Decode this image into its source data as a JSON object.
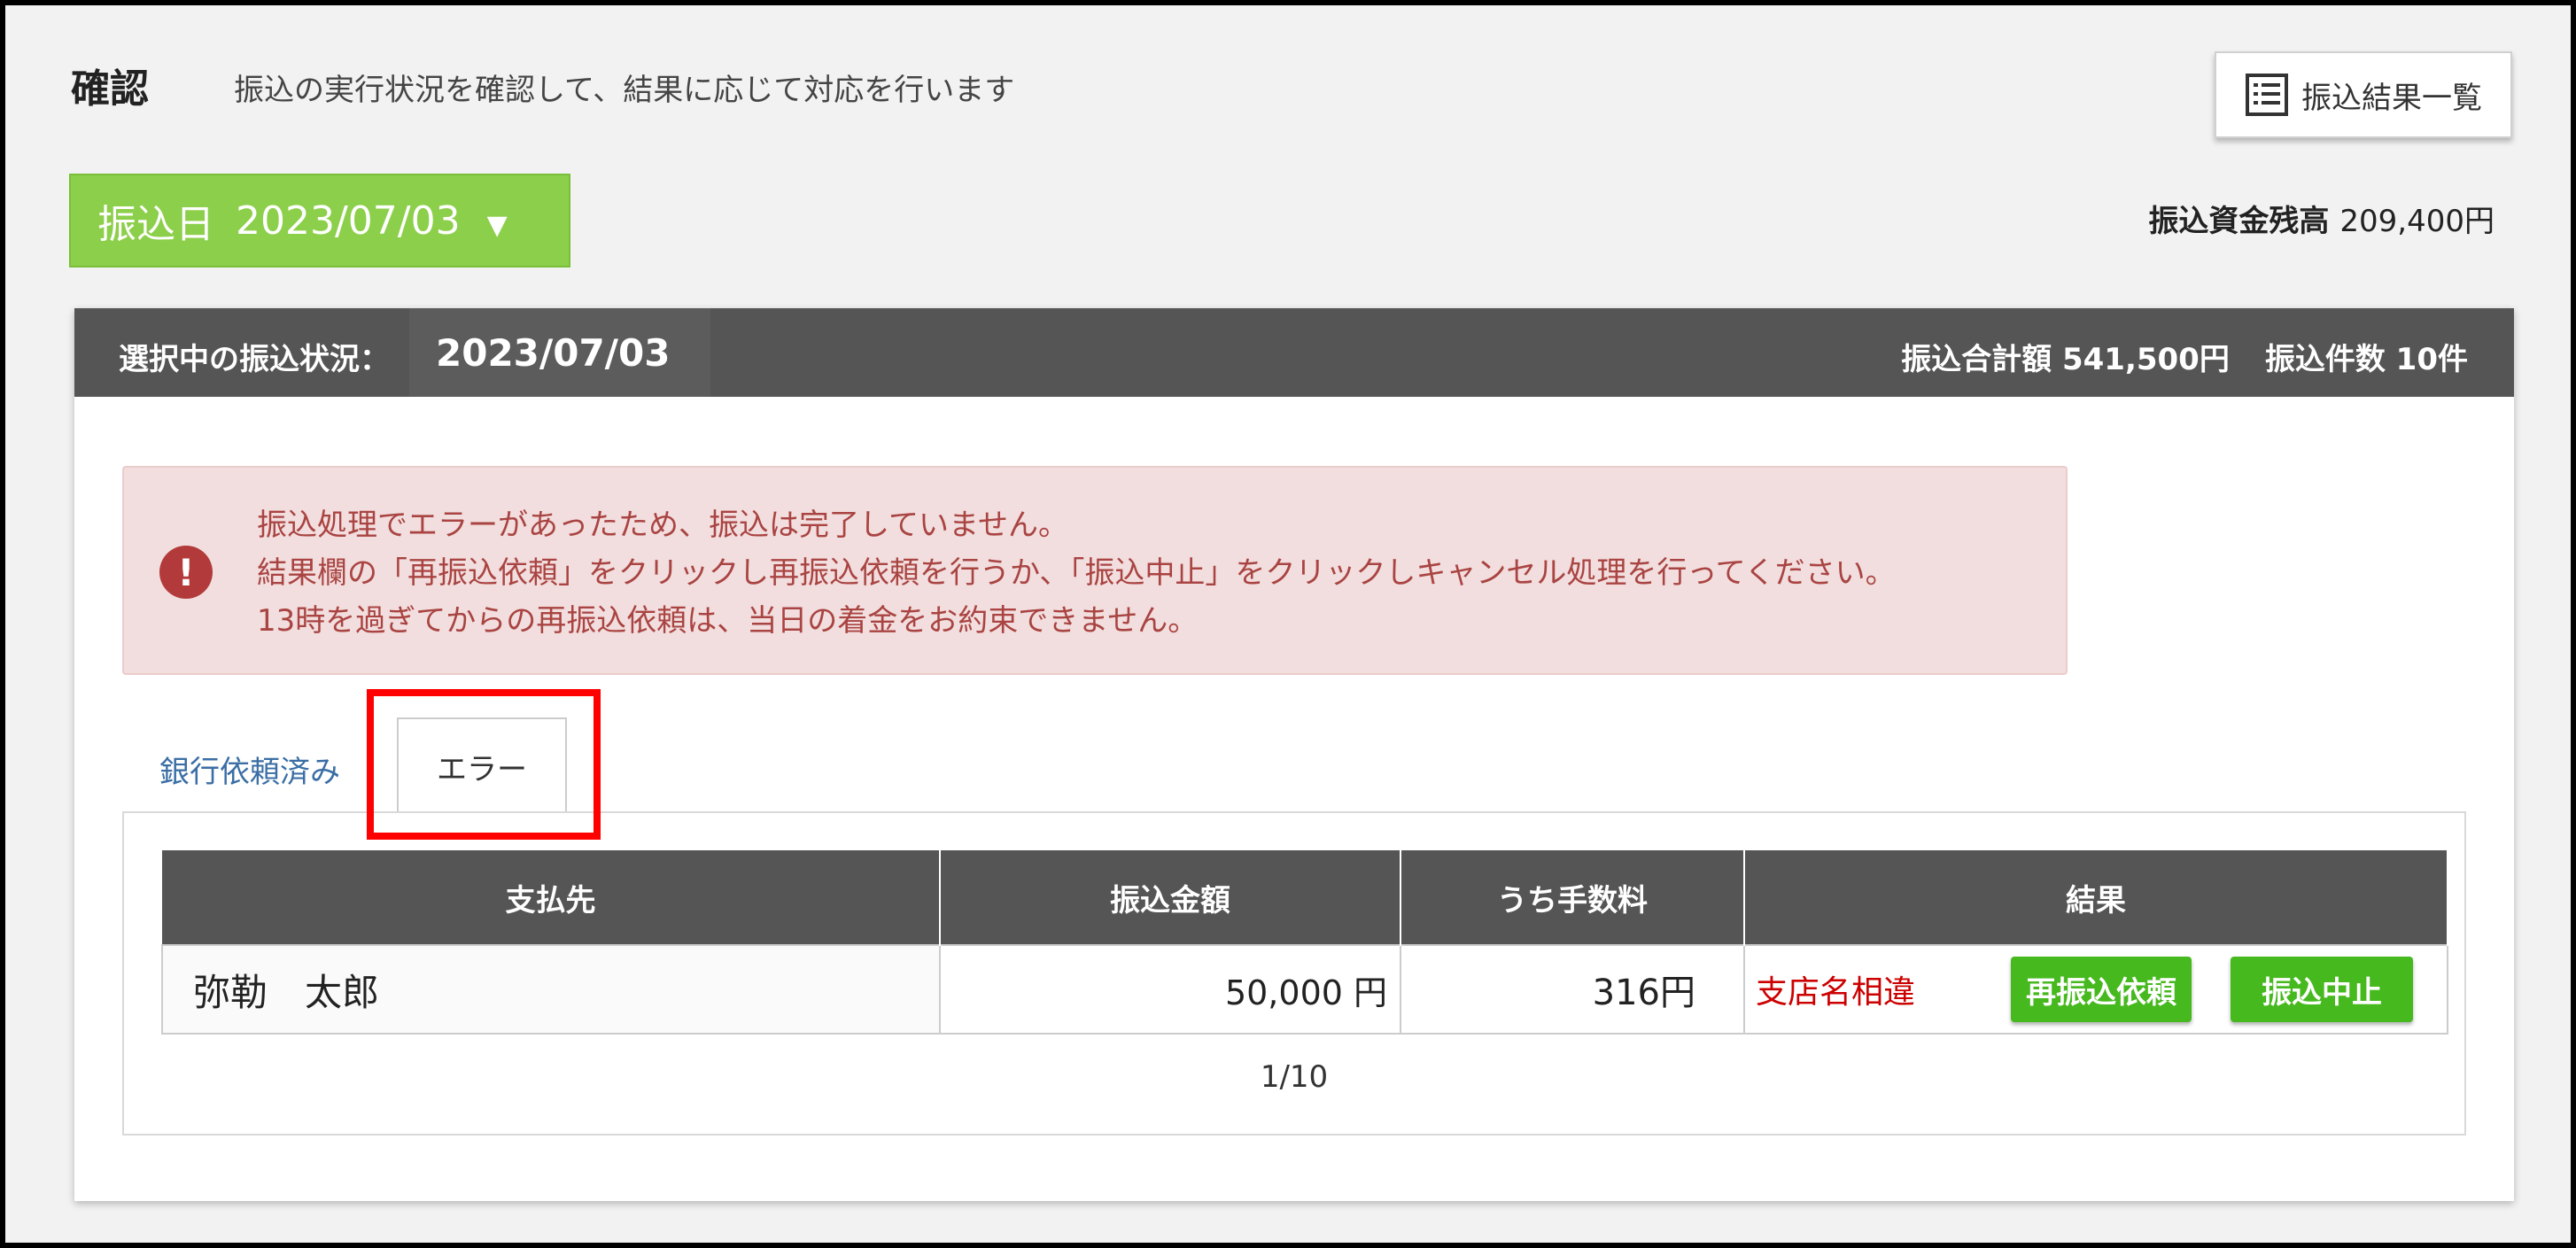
{
  "header": {
    "title": "確認",
    "description": "振込の実行状況を確認して、結果に応じて対応を行います",
    "result_list_button": "振込結果一覧"
  },
  "transfer_date_selector": {
    "label": "振込日",
    "value": "2023/07/03",
    "caret": "▼"
  },
  "balance": {
    "label": "振込資金残高",
    "value": "209,400円"
  },
  "status_bar": {
    "label": "選択中の振込状況：",
    "date": "2023/07/03",
    "total_label": "振込合計額 541,500円",
    "count_label": "振込件数 10件"
  },
  "alert": {
    "icon": "exclamation-circle-icon",
    "lines": [
      "振込処理でエラーがあったため、振込は完了していません。",
      "結果欄の「再振込依頼」をクリックし再振込依頼を行うか、「振込中止」をクリックしキャンセル処理を行ってください。",
      "13時を過ぎてからの再振込依頼は、当日の着金をお約束できません。"
    ]
  },
  "tabs": [
    {
      "label": "銀行依頼済み",
      "active": false
    },
    {
      "label": "エラー",
      "active": true
    }
  ],
  "table": {
    "headers": [
      "支払先",
      "振込金額",
      "うち手数料",
      "結果"
    ],
    "rows": [
      {
        "payee": "弥勒　太郎",
        "amount": "50,000 円",
        "fee": "316円",
        "result": "支店名相違",
        "retry_button": "再振込依頼",
        "cancel_button": "振込中止"
      }
    ]
  },
  "pager": "1/10",
  "colors": {
    "accent_green": "#8ccf4a",
    "button_green": "#46b91e",
    "error_text": "#a94442",
    "highlight_red": "#ff0000",
    "status_bar": "#555555"
  }
}
